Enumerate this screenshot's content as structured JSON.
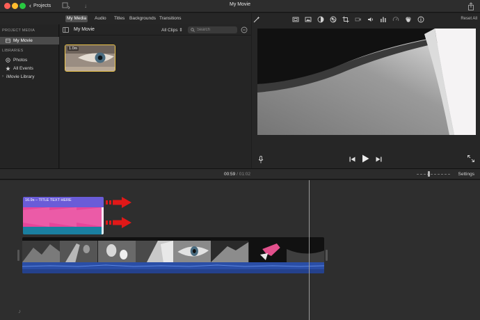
{
  "window": {
    "title": "My Movie",
    "back_label": "Projects"
  },
  "browser_tabs": [
    {
      "label": "My Media",
      "active": true
    },
    {
      "label": "Audio",
      "active": false
    },
    {
      "label": "Titles",
      "active": false
    },
    {
      "label": "Backgrounds",
      "active": false
    },
    {
      "label": "Transitions",
      "active": false
    }
  ],
  "sidebar": {
    "project_heading": "PROJECT MEDIA",
    "project_item": "My Movie",
    "libraries_heading": "LIBRARIES",
    "items": [
      {
        "label": "Photos",
        "icon": "photos-icon"
      },
      {
        "label": "All Events",
        "icon": "star-icon"
      },
      {
        "label": "iMovie Library",
        "icon": "disclosure-triangle-icon"
      }
    ]
  },
  "browser": {
    "title": "My Movie",
    "filter_value": "All Clips",
    "search_placeholder": "Search",
    "clip": {
      "duration": "1.0m"
    }
  },
  "viewer": {
    "reset_label": "Reset All",
    "adjust_icons": [
      "magic-wand-icon",
      "aspect-ratio-icon",
      "image-icon",
      "color-balance-icon",
      "color-correction-icon",
      "crop-icon",
      "camera-stabilization-icon",
      "volume-icon",
      "equalizer-icon",
      "speed-icon",
      "filter-icon",
      "info-icon"
    ]
  },
  "timeline": {
    "current_time": "00:59",
    "separator": "/",
    "total_time": "01:02",
    "settings_label": "Settings",
    "title_clip_label": "16.9s – TITLE TEXT HERE"
  },
  "colors": {
    "title_clip": "#6a5cd8",
    "pink_clip": "#e6459a",
    "clip_bottom": "#1a7fa0",
    "arrow": "#e01818",
    "audio": "#2a4ea6",
    "selection": "#f2c94c"
  }
}
